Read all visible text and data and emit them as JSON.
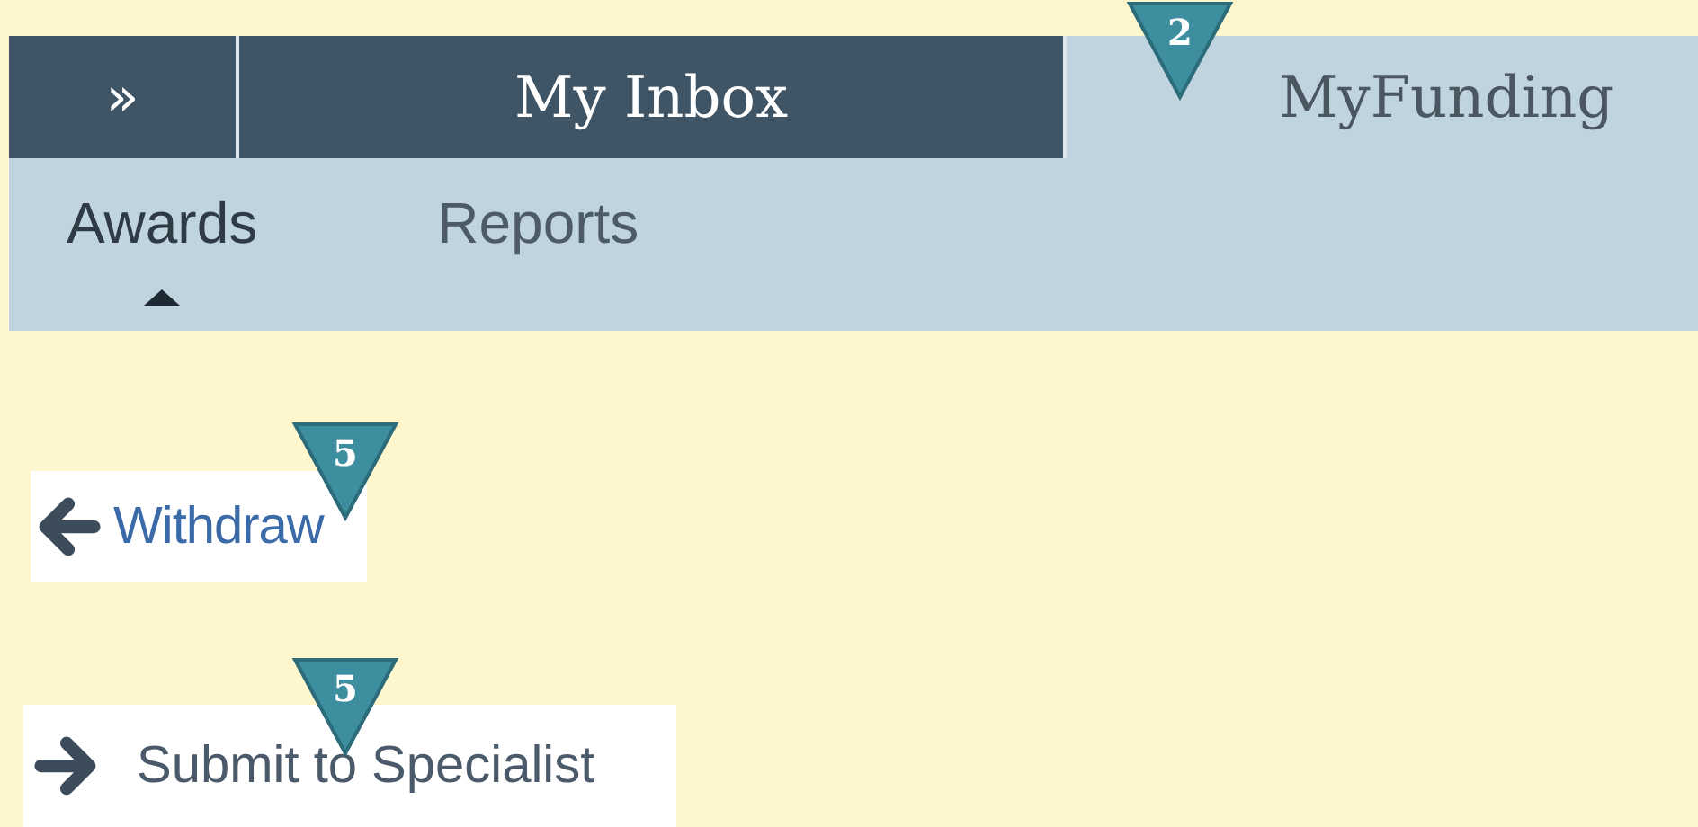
{
  "tabs": [
    {
      "kind": "expand",
      "label": "»",
      "selected": false
    },
    {
      "kind": "tab",
      "label": "My Inbox",
      "selected": false
    },
    {
      "kind": "tab",
      "label": "MyFunding",
      "selected": true,
      "callout": "2"
    }
  ],
  "subtabs": [
    {
      "label": "Awards",
      "selected": true
    },
    {
      "label": "Reports",
      "selected": false
    }
  ],
  "actions": [
    {
      "kind": "link",
      "label": "Withdraw",
      "callout": "5"
    },
    {
      "kind": "button",
      "label": "Submit to Specialist",
      "callout": "5"
    }
  ]
}
